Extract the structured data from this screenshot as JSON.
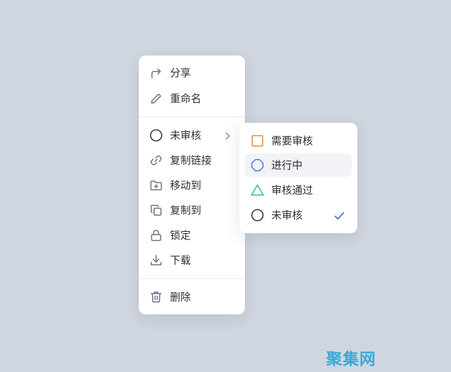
{
  "main_menu": {
    "items": [
      {
        "label": "分享",
        "icon": "share-icon"
      },
      {
        "label": "重命名",
        "icon": "pencil-icon"
      },
      {
        "label": "未审核",
        "icon": "circle-icon",
        "has_submenu": true
      },
      {
        "label": "复制链接",
        "icon": "link-icon"
      },
      {
        "label": "移动到",
        "icon": "folder-plus-icon"
      },
      {
        "label": "复制到",
        "icon": "copy-icon"
      },
      {
        "label": "锁定",
        "icon": "lock-icon"
      },
      {
        "label": "下载",
        "icon": "download-icon"
      },
      {
        "label": "删除",
        "icon": "trash-icon"
      }
    ]
  },
  "status_submenu": {
    "items": [
      {
        "label": "需要审核",
        "icon": "square-icon",
        "color": "#e0893a"
      },
      {
        "label": "进行中",
        "icon": "octagon-icon",
        "color": "#4a78c8",
        "highlighted": true
      },
      {
        "label": "审核通过",
        "icon": "triangle-icon",
        "color": "#2fb8b0"
      },
      {
        "label": "未审核",
        "icon": "circle-icon",
        "color": "#333840",
        "checked": true
      }
    ],
    "check_color": "#4a78c8"
  },
  "watermark": {
    "text": "聚集网"
  },
  "colors": {
    "background": "#cfd6e0",
    "menu_background": "#ffffff",
    "icon_gray": "#6b7280",
    "text": "#2b2f36",
    "watermark": "#3aa9d8"
  }
}
